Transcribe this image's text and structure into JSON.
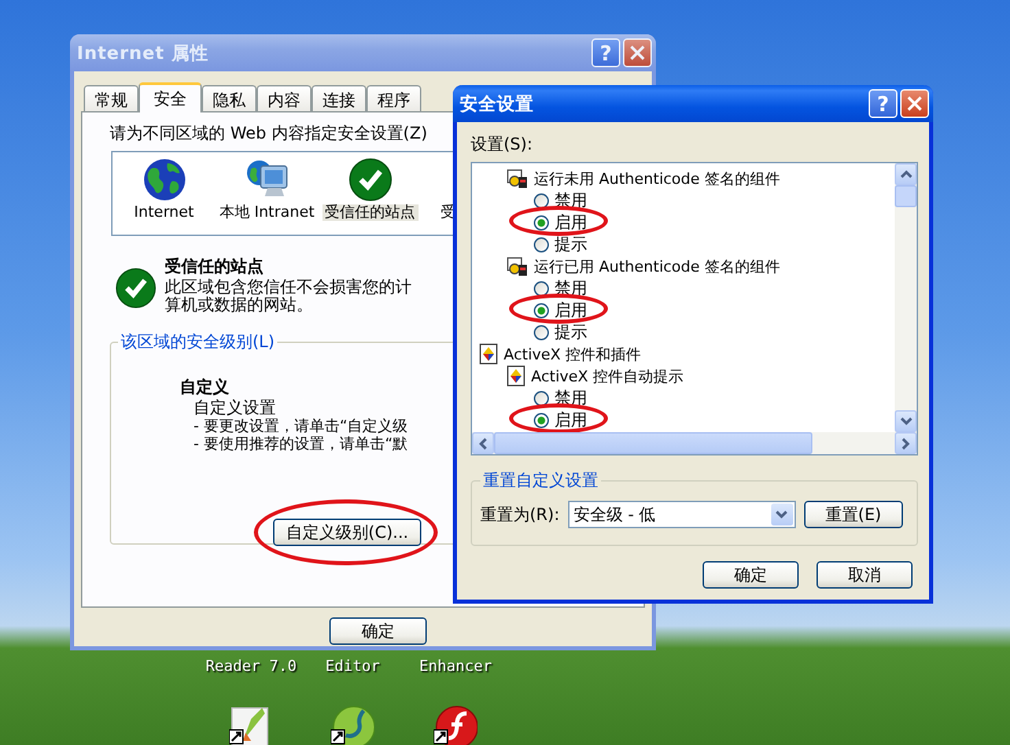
{
  "properties_window": {
    "title": "Internet 属性",
    "help": "?",
    "tabs": [
      {
        "label": "常规",
        "selected": false
      },
      {
        "label": "安全",
        "selected": true
      },
      {
        "label": "隐私",
        "selected": false
      },
      {
        "label": "内容",
        "selected": false
      },
      {
        "label": "连接",
        "selected": false
      },
      {
        "label": "程序",
        "selected": false
      }
    ],
    "prompt": "请为不同区域的 Web 内容指定安全设置(Z)",
    "zones": [
      {
        "label": "Internet",
        "selected": false
      },
      {
        "label": "本地 Intranet",
        "selected": false
      },
      {
        "label": "受信任的站点",
        "selected": true
      },
      {
        "label": "受",
        "selected": false
      }
    ],
    "zone_info": {
      "title": "受信任的站点",
      "description": "此区域包含您信任不会损害您的计算机或数据的网站。"
    },
    "level_group": {
      "legend": "该区域的安全级别(L)",
      "level_name": "自定义",
      "heading": "自定义设置",
      "lines": [
        "- 要更改设置，请单击“自定义级",
        "- 要使用推荐的设置，请单击“默"
      ],
      "custom_button": {
        "label": "自定义级别(C)...",
        "circled": true
      }
    },
    "buttons": [
      "确定"
    ]
  },
  "security_dialog": {
    "title": "安全设置",
    "help": "?",
    "settings_label": "设置(S):",
    "settings": [
      {
        "kind": "signed",
        "label": "运行未用 Authenticode 签名的组件",
        "children": [
          {
            "kind": "option",
            "label": "禁用",
            "selected": false,
            "circled": false
          },
          {
            "kind": "option",
            "label": "启用",
            "selected": true,
            "circled": true
          },
          {
            "kind": "option",
            "label": "提示",
            "selected": false,
            "circled": false
          }
        ]
      },
      {
        "kind": "signed",
        "label": "运行已用 Authenticode 签名的组件",
        "children": [
          {
            "kind": "option",
            "label": "禁用",
            "selected": false,
            "circled": false
          },
          {
            "kind": "option",
            "label": "启用",
            "selected": true,
            "circled": true
          },
          {
            "kind": "option",
            "label": "提示",
            "selected": false,
            "circled": false
          }
        ]
      },
      {
        "kind": "category",
        "label": "ActiveX 控件和插件",
        "children": [
          {
            "kind": "plugin",
            "label": "ActiveX 控件自动提示",
            "children": [
              {
                "kind": "option",
                "label": "禁用",
                "selected": false,
                "circled": false
              },
              {
                "kind": "option",
                "label": "启用",
                "selected": true,
                "circled": true
              }
            ]
          }
        ]
      }
    ],
    "reset_group": {
      "legend": "重置自定义设置",
      "label": "重置为(R):",
      "value": "安全级 - 低",
      "button": "重置(E)"
    },
    "buttons": [
      "确定",
      "取消"
    ]
  },
  "desktop": {
    "icons": [
      {
        "label": "Reader 7.0",
        "kind": "brush"
      },
      {
        "label": "Editor",
        "kind": "ring"
      },
      {
        "label": "Enhancer",
        "kind": "flame"
      }
    ]
  }
}
